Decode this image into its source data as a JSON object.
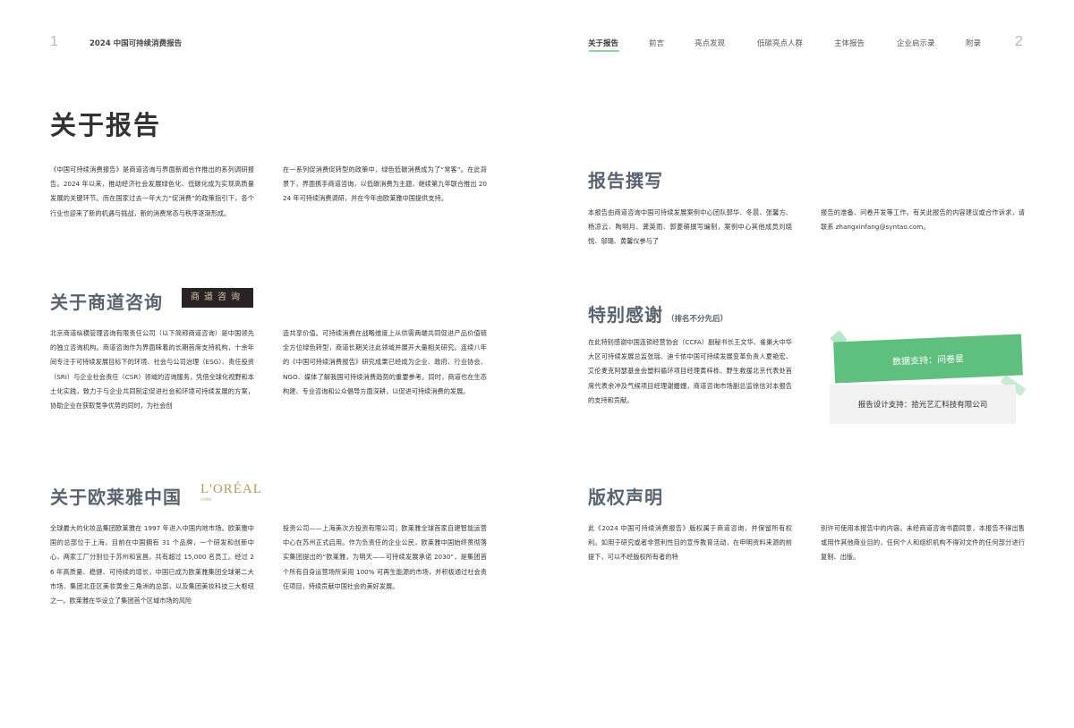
{
  "page": {
    "left_number": "1",
    "right_number": "2",
    "report_title": "2024 中国可持续消费报告"
  },
  "nav": [
    "关于报告",
    "前言",
    "亮点发现",
    "低碳亮点人群",
    "主体报告",
    "企业启示录",
    "附录"
  ],
  "main_title": "关于报告",
  "intro": {
    "col1": "《中国可持续消费报告》是商道咨询与界面新闻合作推出的系列调研报告。2024 年以来，推动经济社会发展绿色化、低碳化成为实现高质量发展的关键环节。而在国家过去一年大力“促消费”的政策指引下，各个行业也迎来了新的机遇与挑战，新的消费常态与秩序逐渐形成。",
    "col2": "在一系列促消费促转型的政策中，绿色低碳消费成为了“常客”。在此背景下，界面携手商道咨询，以低碳消费为主题，继续第九年联合推出 2024 年可持续消费调研，并在今年由欧莱雅中国提供支持。"
  },
  "syntao": {
    "title": "关于商道咨询",
    "logo_text": "商道咨询",
    "col1": "北京商道纵横管理咨询有限责任公司（以下简称商道咨询）是中国领先的独立咨询机构。商道咨询作为界面睐着的长期首席支持机构，十余年间专注于可持续发展目标下的环境、社会与公司治理（ESG）、责任投资（SRI）与企业社会责任（CSR）领域的咨询服务，凭借全球化视野和本土化实践，致力于与企业共同制定促进社会和环境可持续发展的方案，协助企业在获取竞争优势的同时，为社会创",
    "col2": "造共享价值。可持续消费在战略维度上从供需两端共同促进产品价值链全方位绿色转型，商道长期关注此领域并展开大量相关研究。连续八年的《中国可持续消费报告》研究成果已经成为企业、政府、行业协会、NGO、媒体了解我国可持续消费趋势的重要参考。同时，商道也在生态构建、专业咨询和公众倡导方面深耕，以促进可持续消费的发展。"
  },
  "loreal": {
    "title": "关于欧莱雅中国",
    "logo_text": "L'ORÉAL",
    "logo_sub": "CHINA",
    "col1": "全球最大的化妆品集团欧莱雅在 1997 年进入中国内地市场。欧莱雅中国的总部位于上海，目前在中国拥有 31 个品牌，一个研发和创新中心，两家工厂分别位于苏州和宜昌，共有超过 15,000 名员工。经过 26 年高质量、稳健、可持续的增长，中国已成为欧莱雅集团全球第二大市场、集团北亚区美妆黄金三角洲的总部，以及集团美妆科技三大枢纽之一。欧莱雅在华设立了集团首个区域市场的风险",
    "col2": "投资公司——上海美次方投资有限公司；欧莱雅全球首家自建智能运营中心在苏州正式启用。作为负责任的企业公民，欧莱雅中国始终贯彻落实集团提出的“欧莱雅，为明天——可持续发展承诺 2030”，是集团首个所有自身运营场所采用 100% 可再生能源的市场，并积极通过社会责任项目，持续贡献中国社会的美好发展。"
  },
  "writing": {
    "title": "报告撰写",
    "col1": "本报告由商道咨询中国可持续发展案例中心团队郭华、冬晨、张馨方、杨凉云、陶明月、龚英雨、郭菱萌撰写编制，案例中心其他成员刘晓悦、邬璐、黄馨仪参与了",
    "col2": "报告的准备、问卷开发等工作。有关此报告的内容建议或合作诉求，请联系 zhangxinfang@syntao.com。"
  },
  "thanks": {
    "title": "特别感谢",
    "note": "（排名不分先后）",
    "body": "在此特别感谢中国连锁经营协会（CCFA）副秘书长王文华、雀巢大中华大区可持续发展总监张瑶、迪卡侬中国可持续发展变革负责人夏艳宏、艾伦麦克阿瑟基金会塑料循环项目经理黄梓栎、野生救援北京代表处首席代表余冲及气候项目经理谢姗姗，商道咨询市场副总监徐信对本报告的支持和贡献。",
    "data_support": "数据支持：问卷星",
    "design_support": "报告设计支持：拾光艺汇科技有限公司"
  },
  "copyright": {
    "title": "版权声明",
    "col1": "此《2024 中国可持续消费报告》版权属于商道咨询，并保留所有权利。如用于研究或者非营利性目的宣传教育活动，在申明资料来源的前提下，可以不经版权所有者的特",
    "col2": "别许可使用本报告中的内容。未经商道咨询书面同意，本报告不得出售或用作其他商业目的，任何个人和组织机构不得对文件的任何部分进行复制、出版。"
  },
  "colors": {
    "accent_green": "#5fbf7f",
    "heading_grey": "#5a6470"
  }
}
